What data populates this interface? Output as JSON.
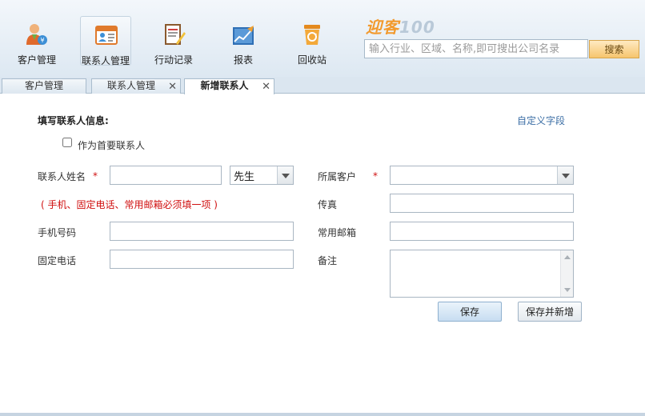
{
  "nav": {
    "items": [
      {
        "label": "客户管理",
        "icon": "customer-icon"
      },
      {
        "label": "联系人管理",
        "icon": "contact-card-icon",
        "active": true
      },
      {
        "label": "行动记录",
        "icon": "notebook-icon"
      },
      {
        "label": "报表",
        "icon": "chart-icon"
      },
      {
        "label": "回收站",
        "icon": "recycle-bin-icon"
      }
    ]
  },
  "logo": {
    "text_main": "迎客",
    "text_num": "100"
  },
  "search": {
    "placeholder": "输入行业、区域、名称,即可搜出公司名录",
    "button_label": "搜索"
  },
  "tabs": [
    {
      "label": "客户管理",
      "closable": false
    },
    {
      "label": "联系人管理",
      "closable": true
    },
    {
      "label": "新增联系人",
      "closable": true,
      "active": true
    }
  ],
  "form": {
    "title": "填写联系人信息:",
    "custom_field_link": "自定义字段",
    "primary_checkbox_label": "作为首要联系人",
    "name_label": "联系人姓名",
    "required_mark": "*",
    "salutation_value": "先生",
    "customer_label": "所属客户",
    "customer_value": "",
    "note_required": "(  手机、固定电话、常用邮箱必须填一项   )",
    "fax_label": "传真",
    "mobile_label": "手机号码",
    "email_label": "常用邮箱",
    "phone_label": "固定电话",
    "remark_label": "备注",
    "save_label": "保存",
    "save_new_label": "保存并新增"
  },
  "colors": {
    "required": "#d01010",
    "link": "#3b6ea5",
    "logo": "#f29a2e"
  }
}
